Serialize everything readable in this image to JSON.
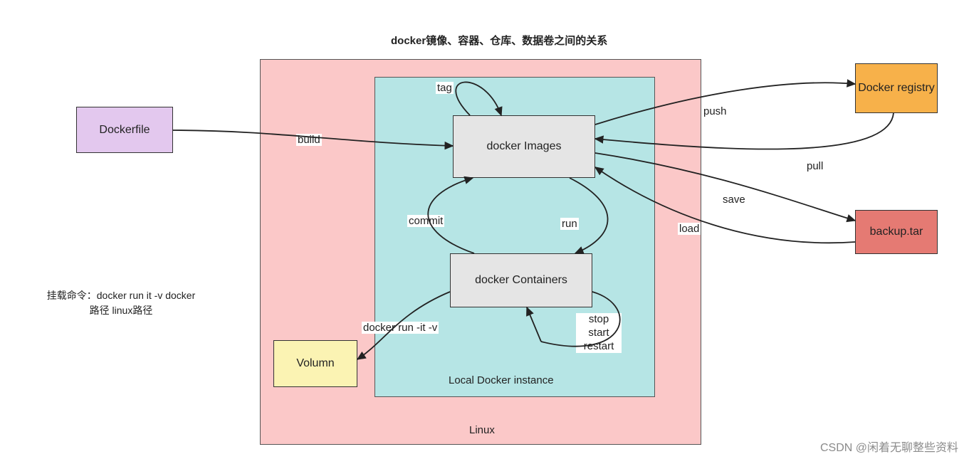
{
  "title": "docker镜像、容器、仓库、数据卷之间的关系",
  "boxes": {
    "linux": "Linux",
    "local_instance": "Local Docker instance",
    "images": "docker Images",
    "containers": "docker Containers",
    "dockerfile": "Dockerfile",
    "volumn": "Volumn",
    "registry": "Docker registry",
    "backup": "backup.tar"
  },
  "labels": {
    "tag": "tag",
    "build": "build",
    "commit": "commit",
    "run": "run",
    "stop_start_restart": "stop\nstart\nrestart",
    "docker_run_v": "docker run -it -v",
    "push": "push",
    "pull": "pull",
    "save": "save",
    "load": "load"
  },
  "note": "挂载命令：docker run it -v docker\n路径 linux路径",
  "watermark": "CSDN @闲着无聊整些资料",
  "colors": {
    "linux_bg": "#FBC8C8",
    "local_bg": "#B6E5E5",
    "inner_bg": "#E5E5E5",
    "dockerfile_bg": "#E3C8EE",
    "volumn_bg": "#FBF3B3",
    "registry_bg": "#F7B14A",
    "backup_bg": "#E57A73"
  }
}
